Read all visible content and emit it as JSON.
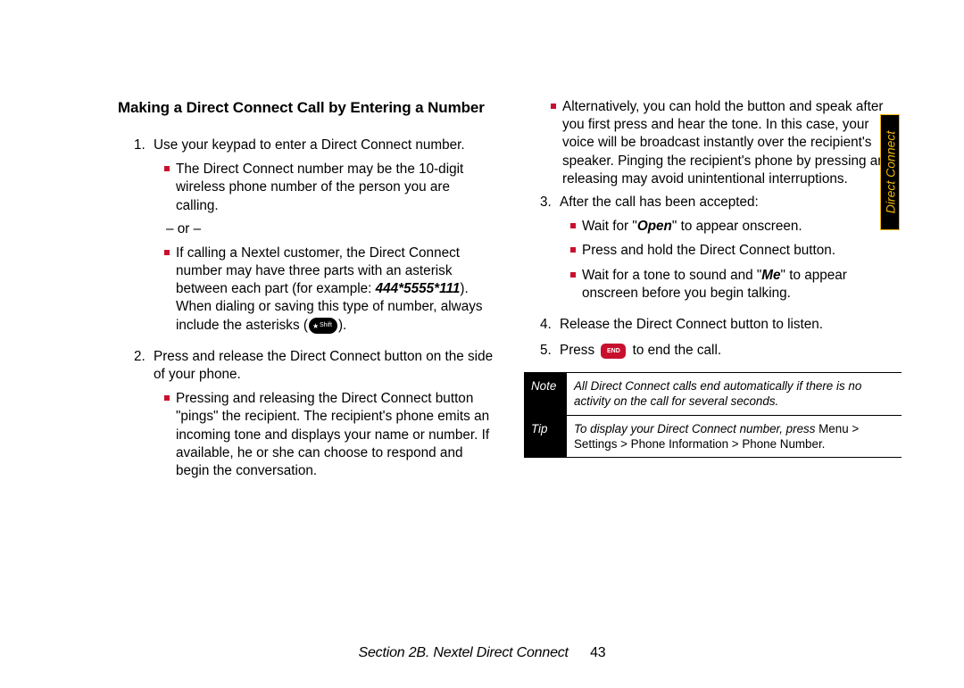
{
  "heading": "Making a Direct Connect Call by Entering a Number",
  "col1": {
    "item1": {
      "num": "1.",
      "text": "Use your keypad to enter a Direct Connect number.",
      "bullets": {
        "b1": "The Direct Connect number may be the 10-digit wireless phone number of the person you are calling.",
        "or": "– or –",
        "b2_pre": "If calling a Nextel customer, the Direct Connect number may have three parts with an asterisk between each part (for example: ",
        "b2_example": "444*5555*111",
        "b2_post": "). When dialing or saving this type of number, always include the asterisks (",
        "b2_close": ")."
      }
    },
    "item2": {
      "num": "2.",
      "text": "Press and release the Direct Connect button on the side of your phone.",
      "bullets": {
        "b1": "Pressing and releasing the Direct Connect button \"pings\" the recipient. The recipient's phone emits an incoming tone and displays your name or number. If available, he or she can choose to respond and begin the conversation."
      }
    }
  },
  "col2": {
    "top_bullet": "Alternatively, you can hold the button and speak after you first press and hear the tone. In this case, your voice will be broadcast instantly over the recipient's speaker. Pinging the recipient's phone by pressing and releasing may avoid unintentional interruptions.",
    "item3": {
      "num": "3.",
      "text": "After the call has been accepted:",
      "bullets": {
        "b1_pre": "Wait for \"",
        "b1_open": "Open",
        "b1_post": "\" to appear onscreen.",
        "b2": "Press and hold the Direct Connect button.",
        "b3_pre": "Wait for a tone to sound and \"",
        "b3_me": "Me",
        "b3_post": "\" to appear onscreen before you begin talking."
      }
    },
    "item4": {
      "num": "4.",
      "text": "Release the Direct Connect button to listen."
    },
    "item5": {
      "num": "5.",
      "text_pre": "Press ",
      "end_key": "END",
      "text_post": " to end the call."
    },
    "note": {
      "label": "Note",
      "text": "All Direct Connect calls end automatically if there is no activity on the call for several seconds."
    },
    "tip": {
      "label": "Tip",
      "text_pre": "To display your Direct Connect number, press ",
      "menu": "Menu",
      "text_post": " > Settings > Phone Information > Phone Number."
    }
  },
  "side_tab": "Direct Connect",
  "footer": {
    "section": "Section 2B. Nextel Direct Connect",
    "page": "43"
  }
}
